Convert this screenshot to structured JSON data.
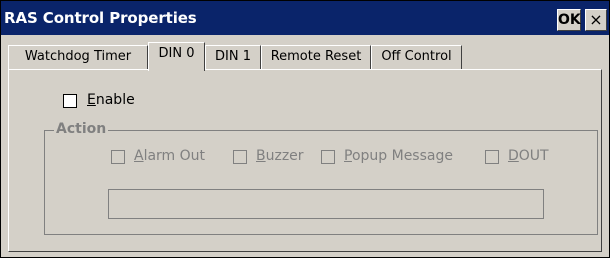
{
  "window": {
    "title": "RAS Control Properties",
    "ok_label": "OK",
    "close_label": "×"
  },
  "tabs": [
    {
      "label": "Watchdog Timer",
      "active": false
    },
    {
      "label": "DIN 0",
      "active": true
    },
    {
      "label": "DIN 1",
      "active": false
    },
    {
      "label": "Remote Reset",
      "active": false
    },
    {
      "label": "Off Control",
      "active": false
    }
  ],
  "enable": {
    "label_underlined": "E",
    "label_rest": "nable",
    "checked": false
  },
  "action": {
    "title": "Action",
    "options": [
      {
        "underlined": "A",
        "rest": "larm Out",
        "checked": false,
        "enabled": false
      },
      {
        "underlined": "B",
        "rest": "uzzer",
        "checked": false,
        "enabled": false
      },
      {
        "underlined": "P",
        "rest": "opup Message",
        "checked": false,
        "enabled": false
      },
      {
        "underlined": "D",
        "rest": "OUT",
        "checked": false,
        "enabled": false
      }
    ],
    "message_value": ""
  },
  "colors": {
    "titlebar": "#0a246a",
    "face": "#d4d0c8",
    "disabled_text": "#808080"
  }
}
